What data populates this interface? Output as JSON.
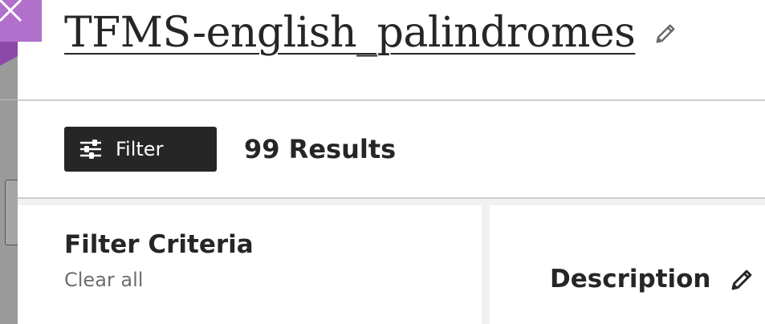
{
  "header": {
    "title": "TFMS-english_palindromes",
    "edit_icon": "pencil-icon"
  },
  "close": {
    "icon": "close-icon",
    "color": "#b070cc"
  },
  "toolbar": {
    "filter_label": "Filter",
    "filter_icon": "sliders-icon",
    "results": "99 Results"
  },
  "filter_panel": {
    "heading": "Filter Criteria",
    "clear_all": "Clear all"
  },
  "details": {
    "description_label": "Description",
    "edit_icon": "pencil-icon"
  },
  "colors": {
    "accent": "#b070cc",
    "button_bg": "#262626",
    "text": "#262626",
    "muted_text": "#6e6e6e",
    "divider": "#cdcdcd"
  }
}
